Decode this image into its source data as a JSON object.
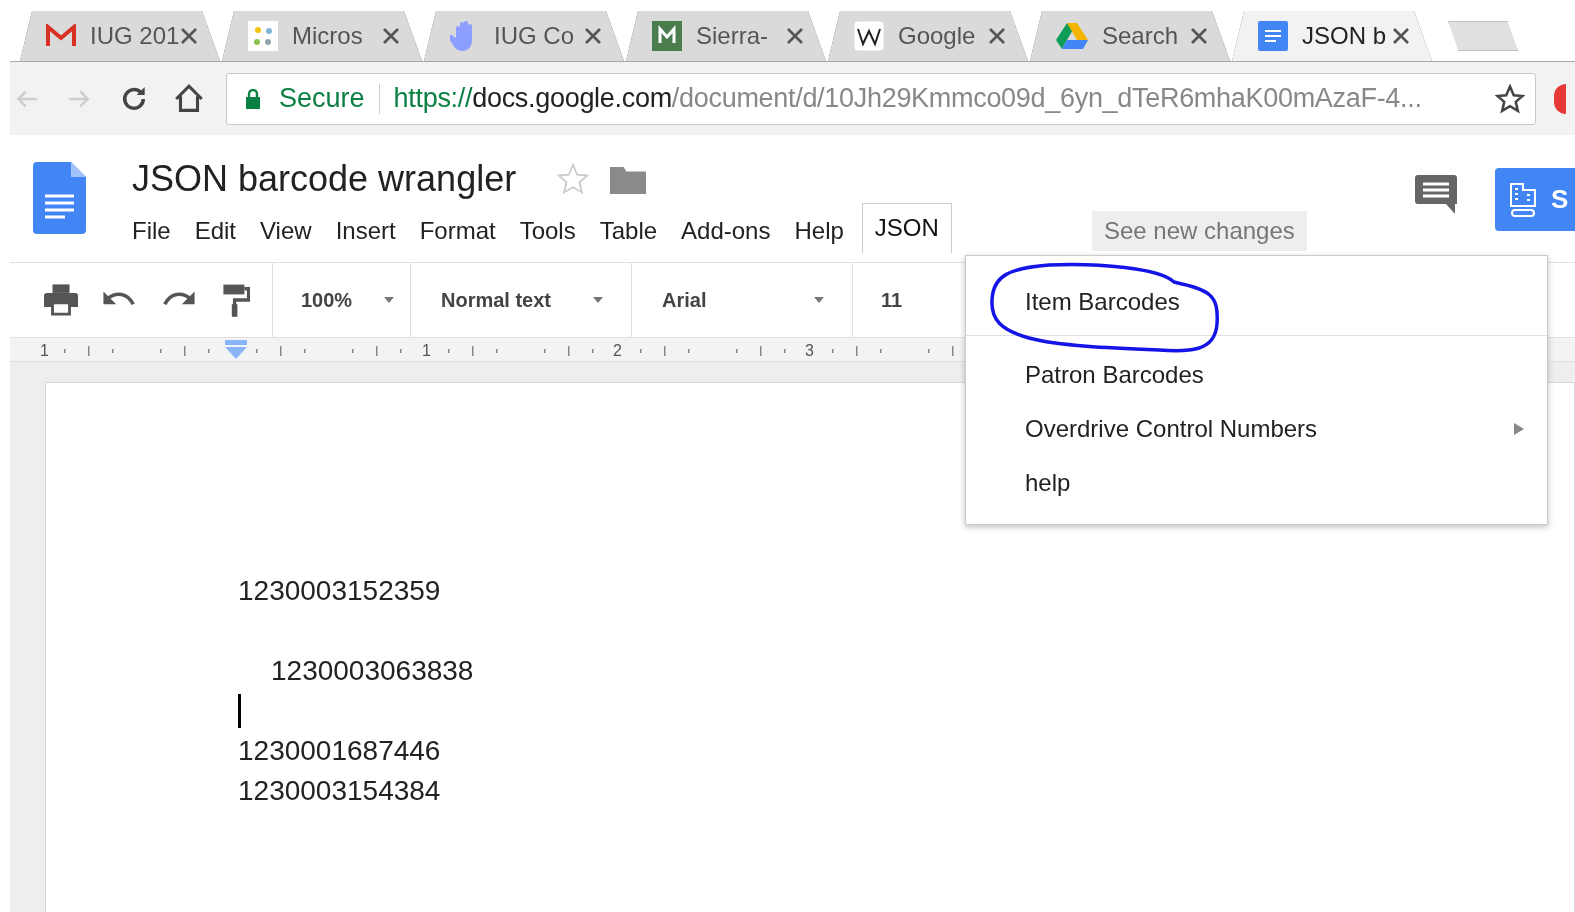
{
  "browser": {
    "tabs": [
      {
        "title": "IUG 201",
        "selected": false
      },
      {
        "title": "Micros",
        "selected": false
      },
      {
        "title": "IUG Co",
        "selected": false
      },
      {
        "title": "Sierra-",
        "selected": false
      },
      {
        "title": "Google",
        "selected": false
      },
      {
        "title": "Search",
        "selected": false
      },
      {
        "title": "JSON b",
        "selected": true
      }
    ],
    "security_label": "Secure",
    "url": {
      "scheme": "https://",
      "host": "docs.google.com",
      "path": "/document/d/10Jh29Kmmco09d_6yn_dTeR6mhaK00mAzaF-4..."
    }
  },
  "document": {
    "title": "JSON barcode wrangler",
    "menu": [
      {
        "label": "File",
        "selected": false
      },
      {
        "label": "Edit",
        "selected": false
      },
      {
        "label": "View",
        "selected": false
      },
      {
        "label": "Insert",
        "selected": false
      },
      {
        "label": "Format",
        "selected": false
      },
      {
        "label": "Tools",
        "selected": false
      },
      {
        "label": "Table",
        "selected": false
      },
      {
        "label": "Add-ons",
        "selected": false
      },
      {
        "label": "Help",
        "selected": false
      },
      {
        "label": "JSON",
        "selected": true
      }
    ],
    "see_new_changes": "See new changes",
    "share_button": "S"
  },
  "toolbar": {
    "zoom": "100%",
    "style": "Normal text",
    "font": "Arial",
    "size": "11"
  },
  "ruler": [
    "1",
    "1",
    "2",
    "3"
  ],
  "dropdown": [
    {
      "label": "Item Barcodes",
      "submenu": false,
      "circled": true,
      "divider_after": true
    },
    {
      "label": "Patron Barcodes",
      "submenu": false,
      "circled": false,
      "divider_after": false
    },
    {
      "label": "Overdrive Control Numbers",
      "submenu": true,
      "circled": false,
      "divider_after": false
    },
    {
      "label": "help",
      "submenu": false,
      "circled": false,
      "divider_after": false
    }
  ],
  "lines": [
    {
      "kind": "text",
      "text": "1230003152359"
    },
    {
      "kind": "blank"
    },
    {
      "kind": "indented_text",
      "text": "1230003063838"
    },
    {
      "kind": "cursor"
    },
    {
      "kind": "text",
      "text": "1230001687446"
    },
    {
      "kind": "text",
      "text": "1230003154384"
    }
  ]
}
